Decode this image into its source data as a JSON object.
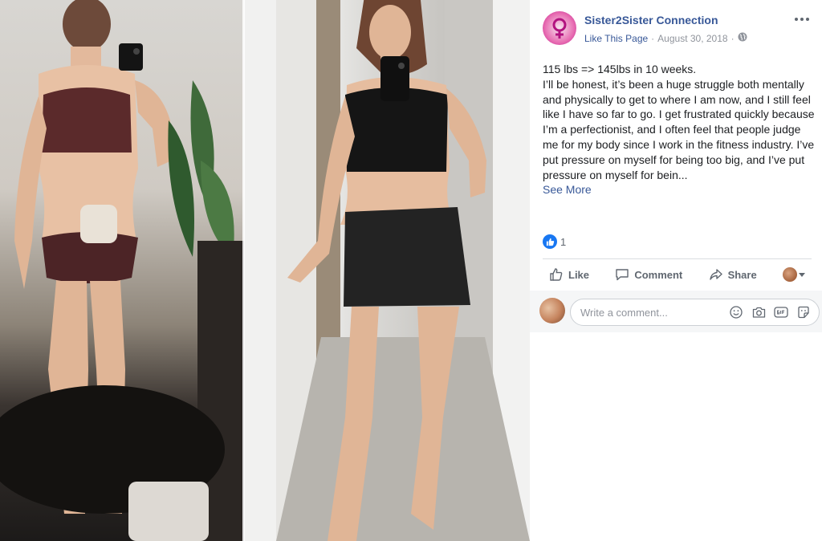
{
  "colors": {
    "brand_blue": "#385898",
    "like_blue": "#1877f2",
    "muted_text": "#90949c",
    "action_text": "#606770",
    "page_avatar_pink": "#c2188a"
  },
  "photo": {
    "icon": "before-after-photo"
  },
  "post": {
    "page_name": "Sister2Sister Connection",
    "like_page": "Like This Page",
    "separator": "·",
    "date": "August 30, 2018",
    "separator2": "·",
    "privacy_icon": "globe-icon",
    "more_icon": "more-options-icon",
    "text": {
      "line1": "115 lbs => 145lbs in 10 weeks.",
      "body": "I’ll be honest, it’s been a huge struggle both mentally and physically to get to where I am now, and I still feel like I have so far to go. I get frustrated quickly because I’m a perfectionist, and I often feel that people judge me for my body since I work in the fitness industry. I’ve put pressure on myself for being too big, and I’ve put pressure on myself for bein...",
      "see_more": "See More"
    },
    "reactions": {
      "icon": "like-reaction-icon",
      "count": "1"
    },
    "actions": {
      "like": "Like",
      "comment": "Comment",
      "share": "Share"
    },
    "comment": {
      "placeholder": "Write a comment...",
      "icons": [
        "emoji-icon",
        "camera-icon",
        "gif-icon",
        "sticker-icon"
      ]
    }
  }
}
